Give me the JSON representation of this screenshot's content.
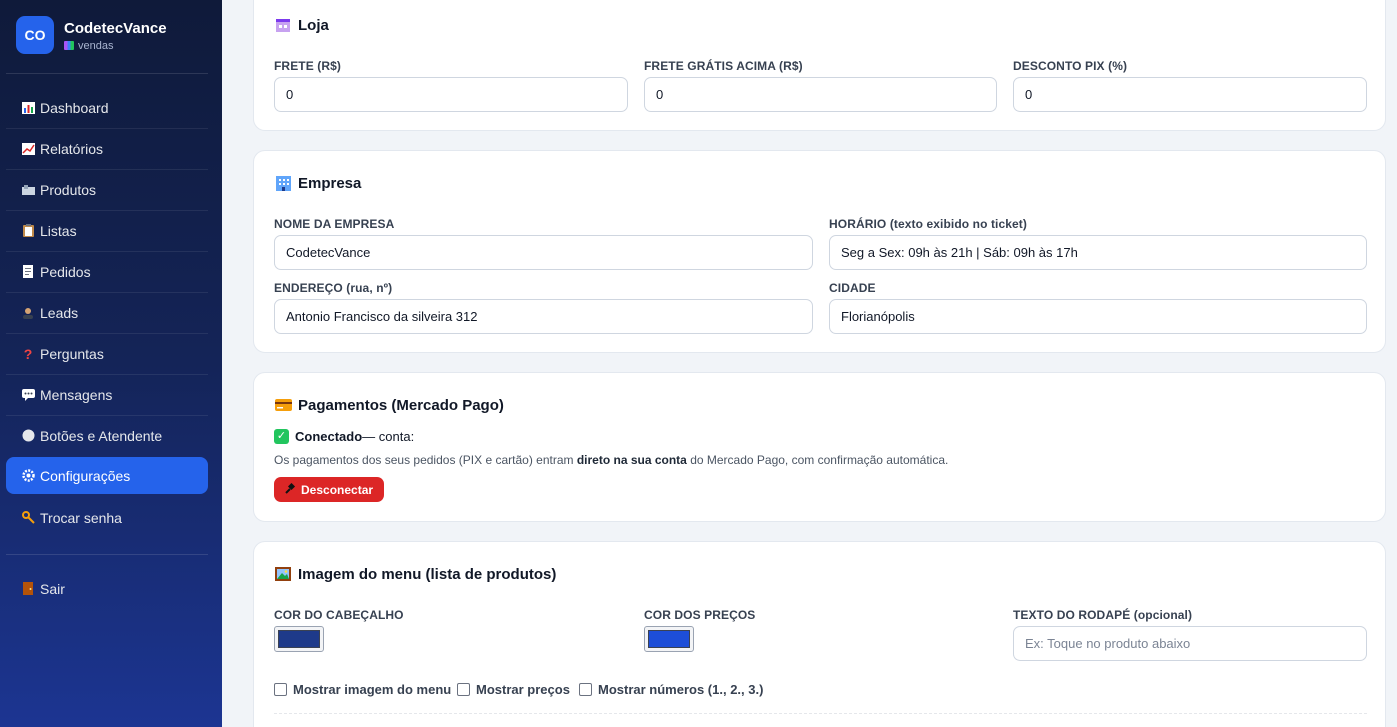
{
  "brand": {
    "logo_text": "CO",
    "name": "CodetecVance",
    "subtitle": "vendas"
  },
  "sidebar": {
    "items": [
      {
        "label": "Dashboard",
        "icon": "bar-chart-icon"
      },
      {
        "label": "Relatórios",
        "icon": "trend-chart-icon"
      },
      {
        "label": "Produtos",
        "icon": "products-icon"
      },
      {
        "label": "Listas",
        "icon": "clipboard-icon"
      },
      {
        "label": "Pedidos",
        "icon": "receipt-icon"
      },
      {
        "label": "Leads",
        "icon": "person-icon"
      },
      {
        "label": "Perguntas",
        "icon": "question-icon"
      },
      {
        "label": "Mensagens",
        "icon": "speech-bubble-icon"
      },
      {
        "label": "Botões e Atendente",
        "icon": "circle-icon"
      },
      {
        "label": "Configurações",
        "icon": "gear-icon",
        "active": true
      },
      {
        "label": "Trocar senha",
        "icon": "key-icon"
      }
    ],
    "logout": {
      "label": "Sair",
      "icon": "door-icon"
    }
  },
  "loja": {
    "title": "Loja",
    "frete_label": "FRETE (R$)",
    "frete_value": "0",
    "frete_gratis_label": "FRETE GRÁTIS ACIMA (R$)",
    "frete_gratis_value": "0",
    "desconto_pix_label": "DESCONTO PIX (%)",
    "desconto_pix_value": "0"
  },
  "empresa": {
    "title": "Empresa",
    "nome_label": "NOME DA EMPRESA",
    "nome_value": "CodetecVance",
    "horario_label": "HORÁRIO",
    "horario_hint": "(texto exibido no ticket)",
    "horario_value": "Seg a Sex: 09h às 21h | Sáb: 09h às 17h",
    "endereco_label": "ENDEREÇO",
    "endereco_hint": "(rua, nº)",
    "endereco_value": "Antonio Francisco da silveira 312",
    "cidade_label": "CIDADE",
    "cidade_value": "Florianópolis"
  },
  "pagamentos": {
    "title": "Pagamentos (Mercado Pago)",
    "status_strong": "Conectado",
    "status_rest": " — conta:",
    "desc_part1": "Os pagamentos dos seus pedidos (PIX e cartão) entram ",
    "desc_bold": "direto na sua conta",
    "desc_part2": " do Mercado Pago, com confirmação automática.",
    "disconnect_label": "Desconectar"
  },
  "imagem_menu": {
    "title": "Imagem do menu (lista de produtos)",
    "cor_cabecalho_label": "COR DO CABEÇALHO",
    "cor_cabecalho_value": "#1e3a8a",
    "cor_precos_label": "COR DOS PREÇOS",
    "cor_precos_value": "#1d4ed8",
    "rodape_label": "TEXTO DO RODAPÉ",
    "rodape_hint": "(opcional)",
    "rodape_placeholder": "Ex: Toque no produto abaixo",
    "checkboxes": [
      {
        "label": "Mostrar imagem do menu",
        "checked": false
      },
      {
        "label": "Mostrar preços",
        "checked": false
      },
      {
        "label": "Mostrar números (1., 2., 3.)",
        "checked": false
      }
    ]
  }
}
